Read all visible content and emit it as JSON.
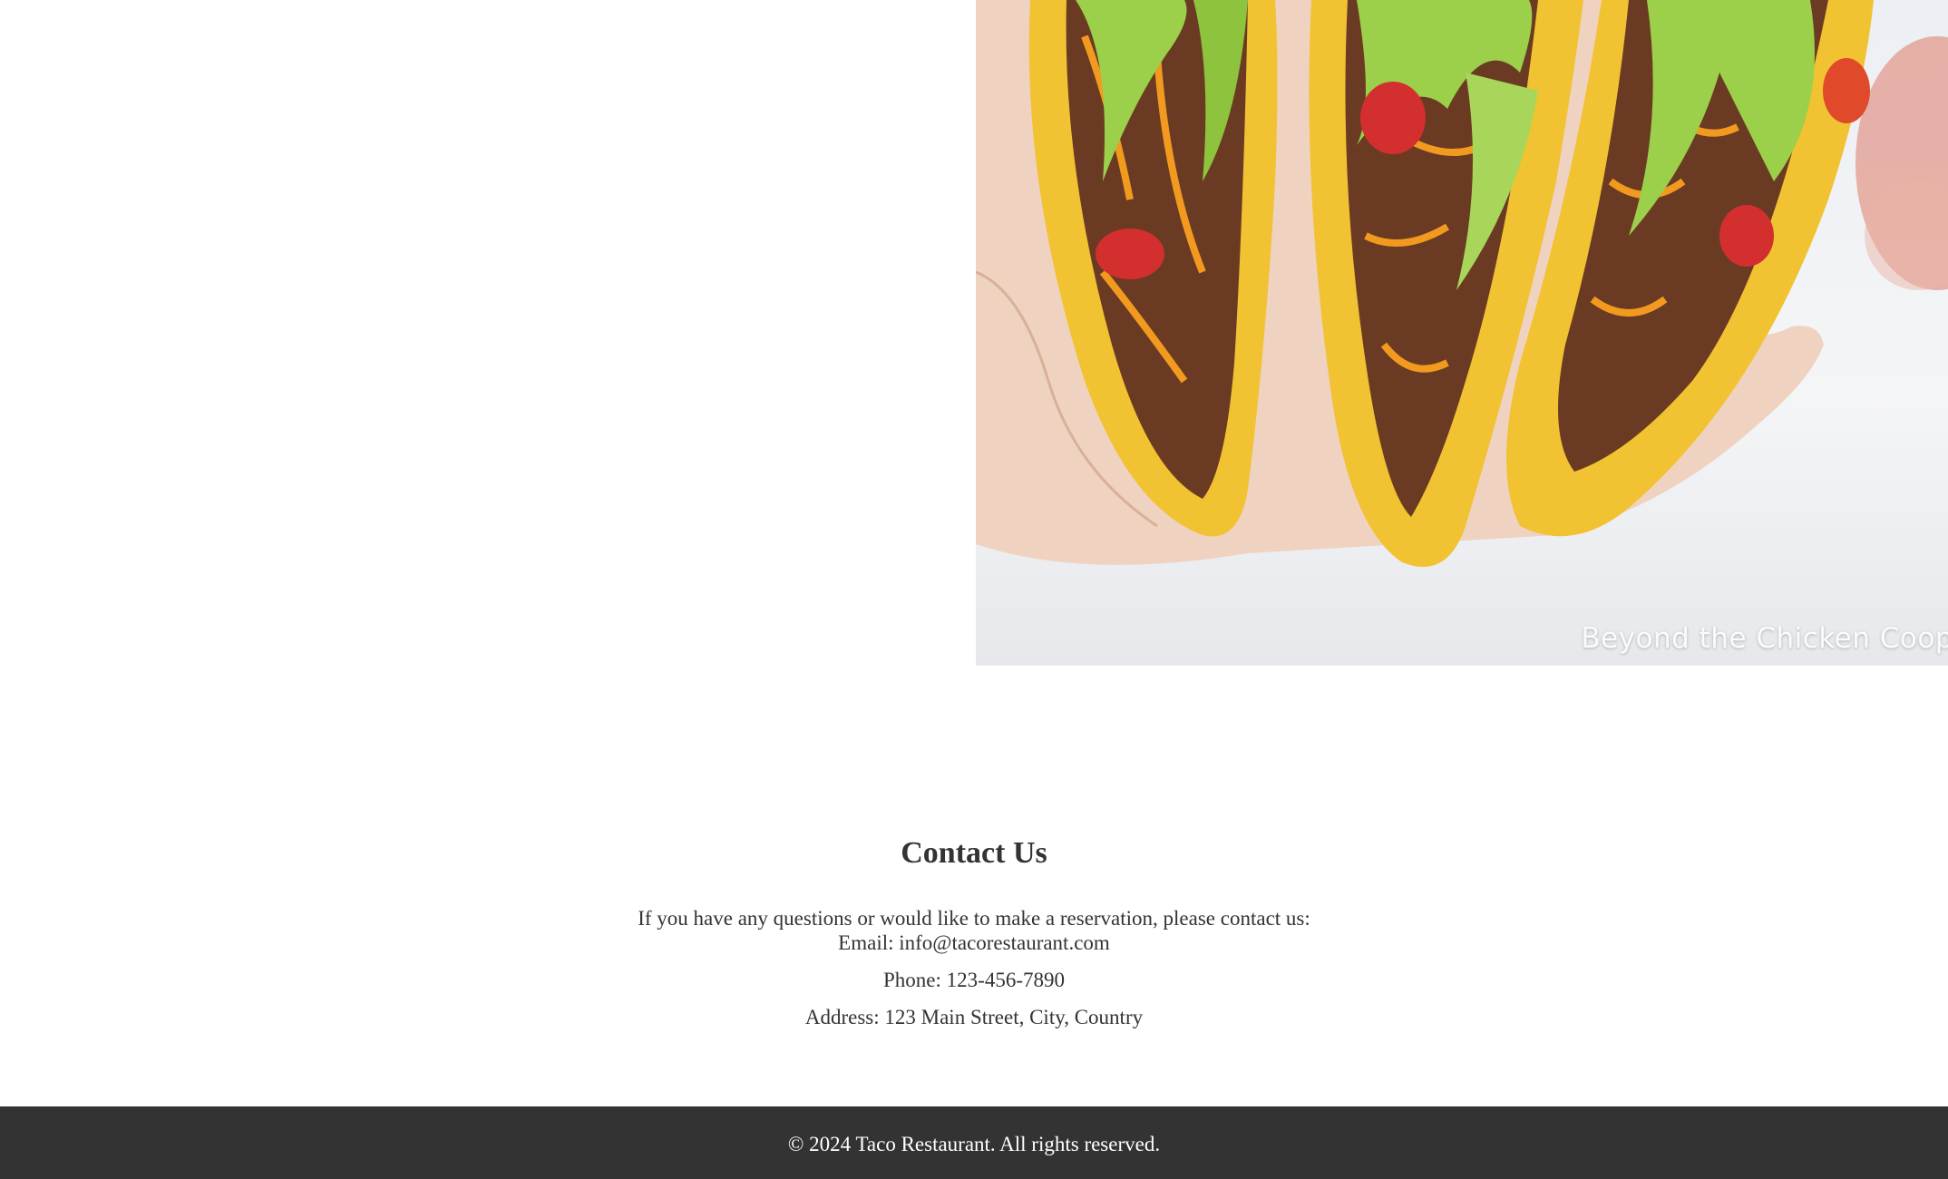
{
  "hero": {
    "image_alt": "Hand holding three crunchy beef tacos with lettuce, tomato and cheese",
    "watermark": "Beyond the Chicken Coop"
  },
  "contact": {
    "title": "Contact Us",
    "intro": "If you have any questions or would like to make a reservation, please contact us:",
    "email": "Email: info@tacorestaurant.com",
    "phone": "Phone: 123-456-7890",
    "address": "Address: 123 Main Street, City, Country"
  },
  "footer": {
    "copyright": "© 2024 Taco Restaurant. All rights reserved."
  }
}
